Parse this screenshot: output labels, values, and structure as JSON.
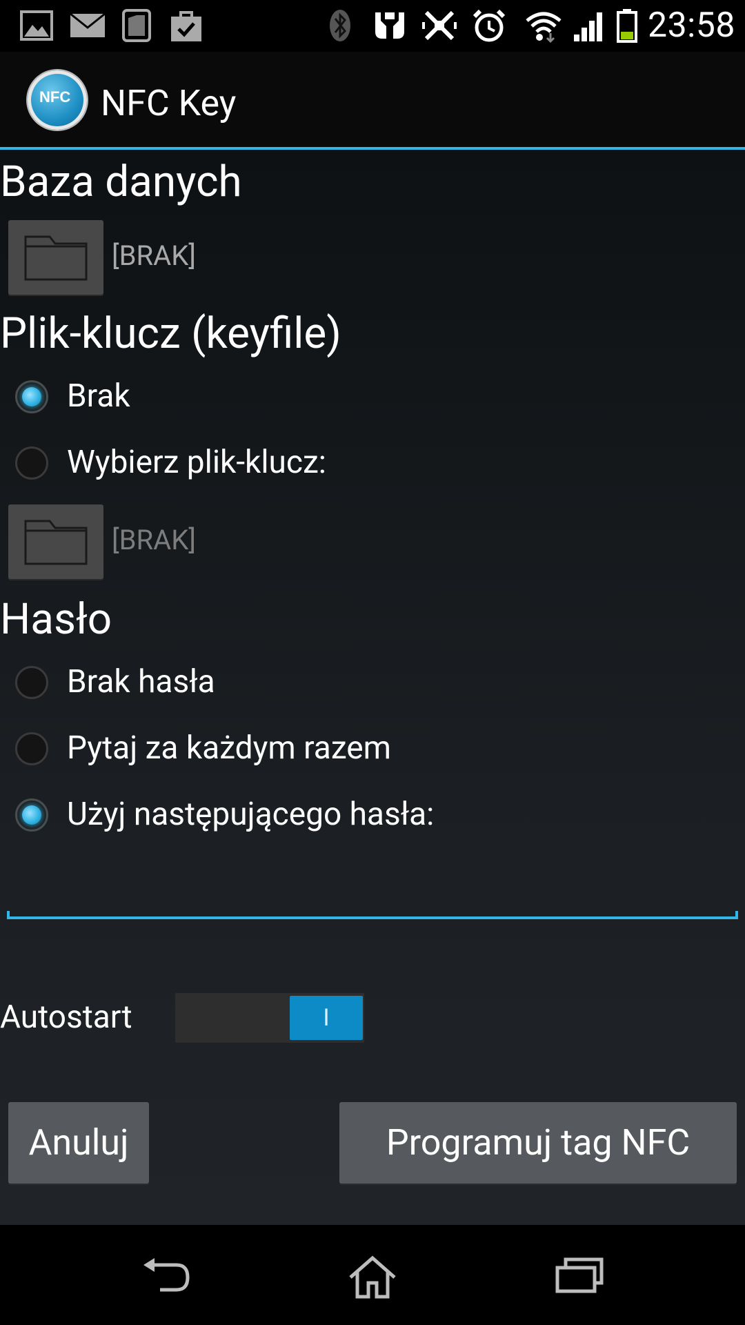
{
  "status_bar": {
    "time": "23:58",
    "icons": [
      "gallery-icon",
      "email-icon",
      "sim-card-icon",
      "shopping-bag-icon",
      "bluetooth-icon",
      "nfc-icon",
      "vibrate-icon",
      "alarm-icon",
      "wifi-icon",
      "signal-icon",
      "battery-icon"
    ]
  },
  "action_bar": {
    "logo_text": "NFC",
    "title": "NFC Key"
  },
  "database": {
    "title": "Baza danych",
    "path": "[BRAK]"
  },
  "keyfile": {
    "title": "Plik-klucz (keyfile)",
    "options": [
      {
        "label": "Brak",
        "checked": true
      },
      {
        "label": "Wybierz plik-klucz:",
        "checked": false
      }
    ],
    "path": "[BRAK]"
  },
  "password": {
    "title": "Hasło",
    "options": [
      {
        "label": "Brak hasła",
        "checked": false
      },
      {
        "label": "Pytaj za każdym razem",
        "checked": false
      },
      {
        "label": "Użyj następującego hasła:",
        "checked": true
      }
    ],
    "value": ""
  },
  "autostart": {
    "label": "Autostart",
    "switch_text": "I",
    "on": true
  },
  "buttons": {
    "cancel": "Anuluj",
    "program": "Programuj tag NFC"
  },
  "nav_bar": {
    "icons": [
      "back-icon",
      "home-icon",
      "recent-apps-icon"
    ]
  },
  "colors": {
    "accent": "#33b5e5",
    "switch_on": "#0d8bc6"
  }
}
